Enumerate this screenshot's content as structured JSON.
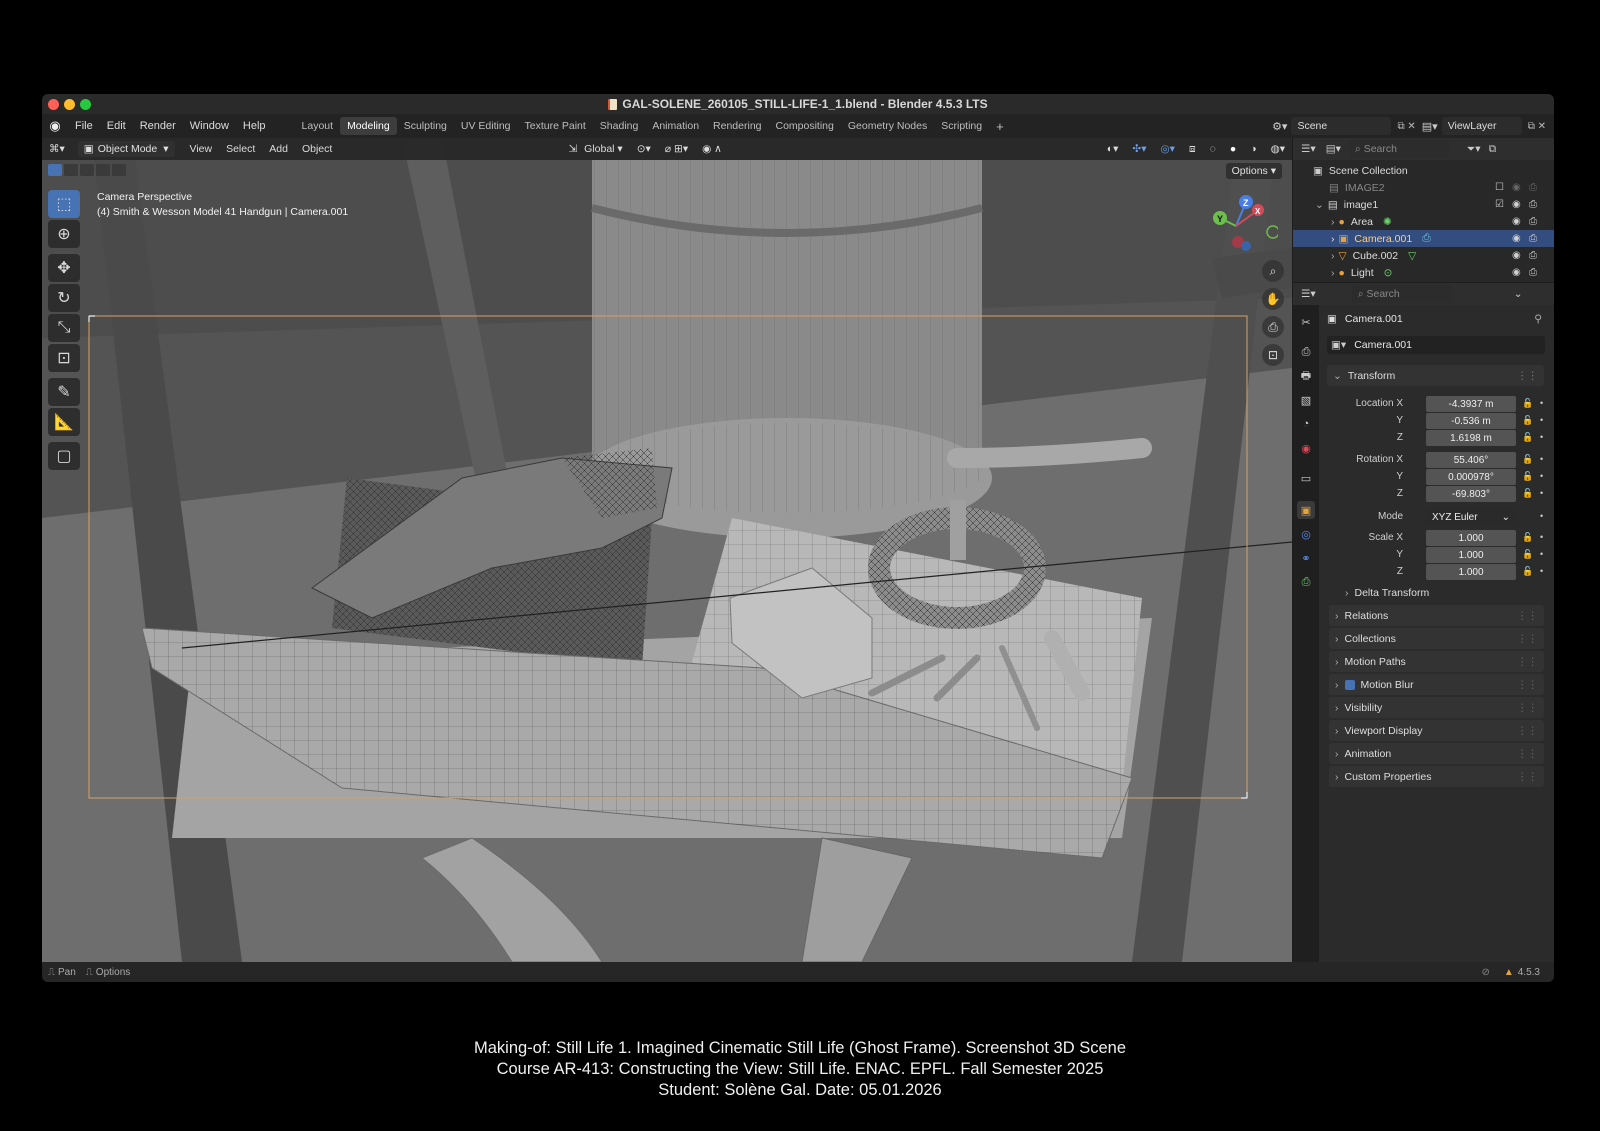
{
  "window": {
    "title": "GAL-SOLENE_260105_STILL-LIFE-1_1.blend - Blender 4.5.3 LTS"
  },
  "menu": [
    "File",
    "Edit",
    "Render",
    "Window",
    "Help"
  ],
  "workspaces": [
    {
      "label": "Layout",
      "active": false
    },
    {
      "label": "Modeling",
      "active": true
    },
    {
      "label": "Sculpting",
      "active": false
    },
    {
      "label": "UV Editing",
      "active": false
    },
    {
      "label": "Texture Paint",
      "active": false
    },
    {
      "label": "Shading",
      "active": false
    },
    {
      "label": "Animation",
      "active": false
    },
    {
      "label": "Rendering",
      "active": false
    },
    {
      "label": "Compositing",
      "active": false
    },
    {
      "label": "Geometry Nodes",
      "active": false
    },
    {
      "label": "Scripting",
      "active": false
    }
  ],
  "add_workspace_glyph": "+",
  "scene": {
    "label": "Scene",
    "viewlayer": "ViewLayer"
  },
  "viewport": {
    "mode": "Object Mode",
    "menus": [
      "View",
      "Select",
      "Add",
      "Object"
    ],
    "transform_orientation": "Global",
    "options_label": "Options",
    "overlay_line1": "Camera Perspective",
    "overlay_line2": "(4) Smith & Wesson Model 41 Handgun | Camera.001",
    "gizmo": {
      "z": "Z",
      "y": "Y",
      "x": "X"
    }
  },
  "outliner": {
    "search_placeholder": "Search",
    "root": "Scene Collection",
    "rows": [
      {
        "label": "IMAGE2",
        "indent": 1,
        "dim": true,
        "selected": false
      },
      {
        "label": "image1",
        "indent": 1,
        "dim": false,
        "selected": false
      },
      {
        "label": "Area",
        "indent": 2,
        "dim": false,
        "selected": false
      },
      {
        "label": "Camera.001",
        "indent": 2,
        "dim": false,
        "selected": true
      },
      {
        "label": "Cube.002",
        "indent": 2,
        "dim": false,
        "selected": false
      },
      {
        "label": "Light",
        "indent": 2,
        "dim": false,
        "selected": false
      }
    ]
  },
  "properties": {
    "search_placeholder": "Search",
    "object_name": "Camera.001",
    "datablock_name": "Camera.001",
    "transform_header": "Transform",
    "location_label": "Location X",
    "rotation_label": "Rotation X",
    "scale_label": "Scale X",
    "y_label": "Y",
    "z_label": "Z",
    "location": [
      "-4.3937 m",
      "-0.536 m",
      "1.6198 m"
    ],
    "rotation": [
      "55.406°",
      "0.000978°",
      "-69.803°"
    ],
    "mode_label": "Mode",
    "mode_value": "XYZ Euler",
    "scale": [
      "1.000",
      "1.000",
      "1.000"
    ],
    "delta_transform": "Delta Transform",
    "panels": [
      "Relations",
      "Collections",
      "Motion Paths",
      "Motion Blur",
      "Visibility",
      "Viewport Display",
      "Animation",
      "Custom Properties"
    ]
  },
  "status": {
    "pan": "Pan",
    "options": "Options",
    "version": "4.5.3"
  },
  "caption": {
    "line1": "Making-of: Still Life 1. Imagined Cinematic Still Life (Ghost Frame). Screenshot 3D Scene",
    "line2": "Course AR-413: Constructing the View: Still Life. ENAC. EPFL. Fall Semester 2025",
    "line3": "Student: Solène Gal. Date: 05.01.2026"
  },
  "colors": {
    "accent": "#4772b3",
    "camera_frame": "#d8a065",
    "selected_row": "#334d80",
    "warning": "#e6a23c"
  }
}
